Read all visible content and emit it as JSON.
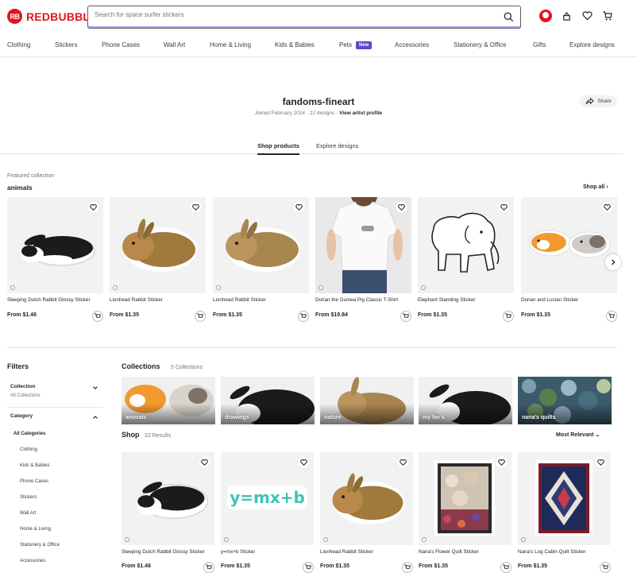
{
  "header": {
    "logo_text": "REDBUBBLE",
    "logo_mark": "RB",
    "search_placeholder": "Search for space surfer stickers",
    "icons": [
      "avatar",
      "dashboard-icon",
      "heart-icon",
      "cart-icon"
    ],
    "brand_color": "#e41321"
  },
  "nav": {
    "items": [
      "Clothing",
      "Stickers",
      "Phone Cases",
      "Wall Art",
      "Home & Living",
      "Kids & Babies",
      "Pets",
      "Accessories",
      "Stationery & Office",
      "Gifts",
      "Explore designs"
    ],
    "pets_badge": "New",
    "badge_color": "#5b49c9"
  },
  "artist": {
    "name": "fandoms-fineart",
    "joined": "Joined February 2014",
    "designs": "22 designs",
    "view_profile": "View artist profile",
    "share_label": "Share"
  },
  "tabs": [
    "Shop products",
    "Explore designs"
  ],
  "featured": {
    "label": "Featured collection",
    "title": "animals",
    "shop_all": "Shop all",
    "products": [
      {
        "title": "Sleeping Dutch Rabbit Glossy Sticker",
        "price": "From $1.46",
        "image": "dutch-rabbit"
      },
      {
        "title": "Lionhead Rabbit Sticker",
        "price": "From $1.35",
        "image": "lionhead-rabbit"
      },
      {
        "title": "Lionhead Rabbit Sticker",
        "price": "From $1.35",
        "image": "lionhead-rabbit"
      },
      {
        "title": "Dorian the Guinea Pig Classic T-Shirt",
        "price": "From $19.84",
        "image": "tshirt"
      },
      {
        "title": "Elephant Standing Sticker",
        "price": "From $1.35",
        "image": "elephant"
      },
      {
        "title": "Dorian and Lucian Sticker",
        "price": "From $1.35",
        "image": "guinea-pigs"
      }
    ]
  },
  "filters": {
    "title": "Filters",
    "collection_label": "Collection",
    "collection_value": "All Collections",
    "category_label": "Category",
    "category_items": [
      "All Categories",
      "Clothing",
      "Kids & Babies",
      "Phone Cases",
      "Stickers",
      "Wall Art",
      "Home & Living",
      "Stationery & Office",
      "Accessories"
    ]
  },
  "collections": {
    "title": "Collections",
    "count": "5 Collections",
    "items": [
      "animals",
      "drawings",
      "nature",
      "my fav's",
      "nana's quilts"
    ]
  },
  "shop": {
    "title": "Shop",
    "count": "22 Results",
    "sort_label": "Most Relevant",
    "products": [
      {
        "title": "Sleeping Dutch Rabbit Glossy Sticker",
        "price": "From $1.46",
        "image": "dutch-rabbit"
      },
      {
        "title": "y=mx+b Sticker",
        "price": "From $1.35",
        "image": "equation",
        "equation_text": "y=mx+b"
      },
      {
        "title": "Lionhead Rabbit Sticker",
        "price": "From $1.35",
        "image": "lionhead-rabbit"
      },
      {
        "title": "Nana's Flower Quilt Sticker",
        "price": "From $1.35",
        "image": "flower-quilt"
      },
      {
        "title": "Nana's Log Cabin Quilt Sticker",
        "price": "From $1.35",
        "image": "log-cabin-quilt"
      }
    ]
  }
}
